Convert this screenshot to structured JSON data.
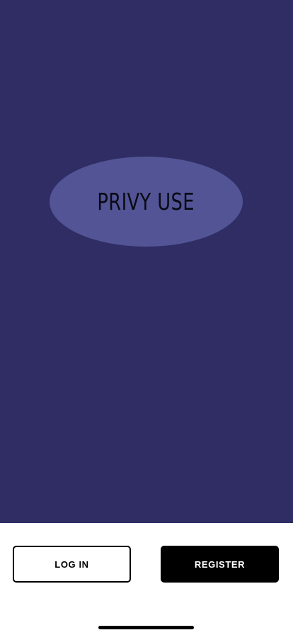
{
  "hero": {
    "logo_text": "PRIVY USE"
  },
  "actions": {
    "login_label": "LOG IN",
    "register_label": "REGISTER"
  },
  "colors": {
    "background": "#2f2d64",
    "logo_ellipse": "#525496",
    "footer": "#ffffff",
    "register_button": "#000000"
  }
}
